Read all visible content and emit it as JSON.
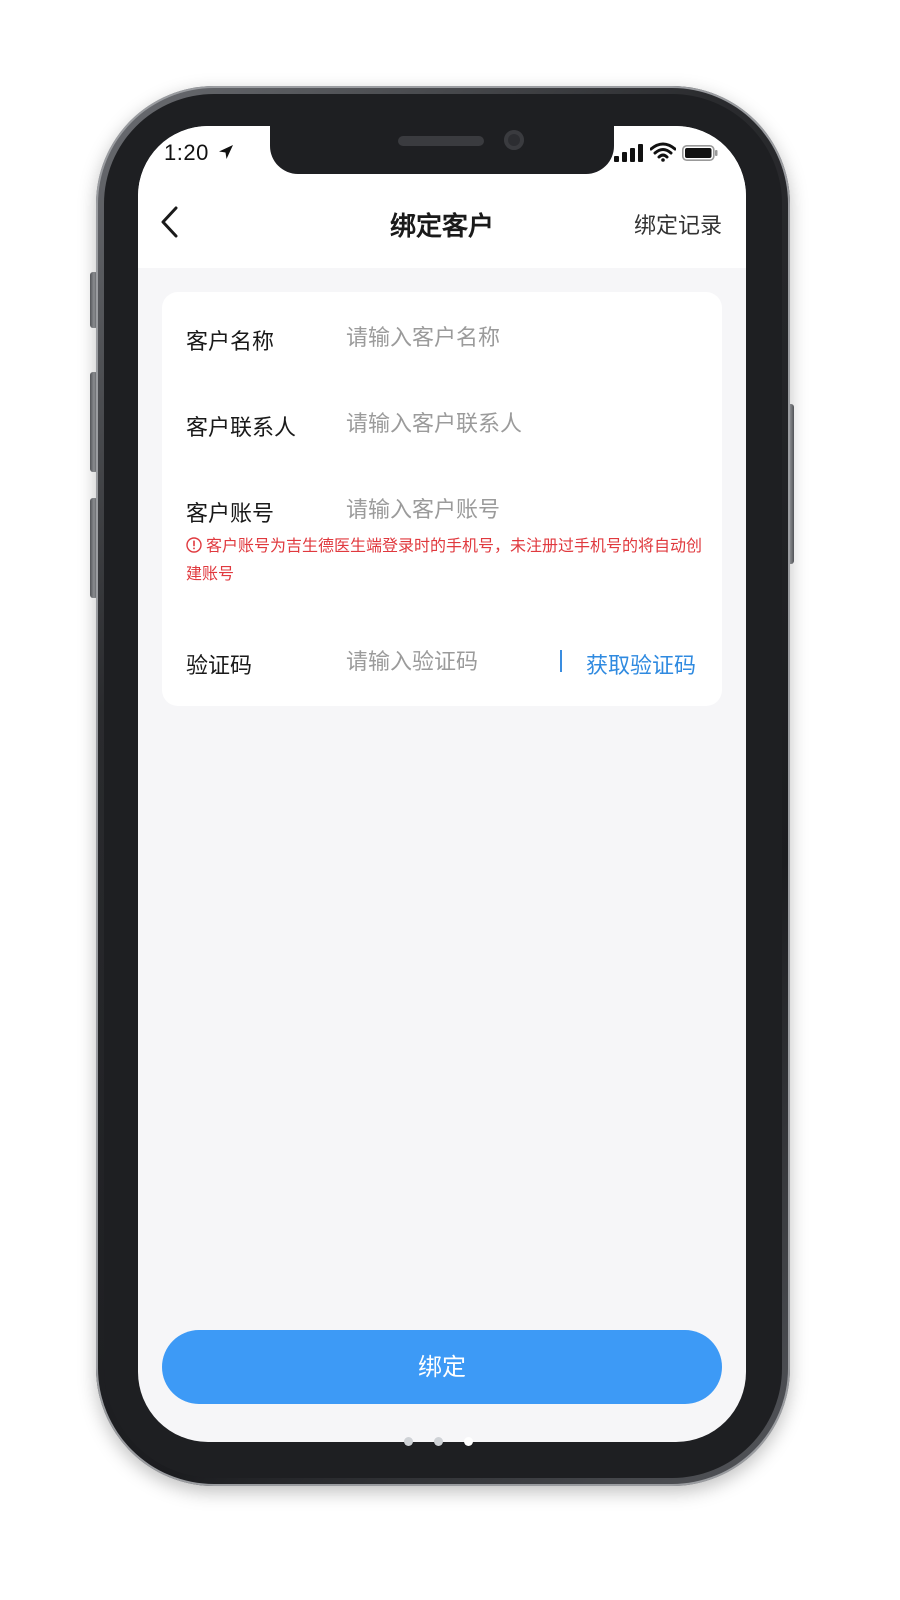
{
  "status_bar": {
    "time": "1:20"
  },
  "nav": {
    "title": "绑定客户",
    "right_link": "绑定记录"
  },
  "form": {
    "fields": [
      {
        "label": "客户名称",
        "placeholder": "请输入客户名称"
      },
      {
        "label": "客户联系人",
        "placeholder": "请输入客户联系人"
      },
      {
        "label": "客户账号",
        "placeholder": "请输入客户账号"
      },
      {
        "label": "验证码",
        "placeholder": "请输入验证码"
      }
    ],
    "account_warning": "客户账号为吉生德医生端登录时的手机号，未注册过手机号的将自动创建账号",
    "get_code_label": "获取验证码"
  },
  "submit_label": "绑定",
  "colors": {
    "accent": "#3d9af6",
    "link": "#2f8ae0",
    "warning": "#e0393e"
  },
  "icons": [
    "back-chevron-icon",
    "location-arrow-icon",
    "signal-icon",
    "wifi-icon",
    "battery-icon",
    "warning-circle-icon"
  ]
}
